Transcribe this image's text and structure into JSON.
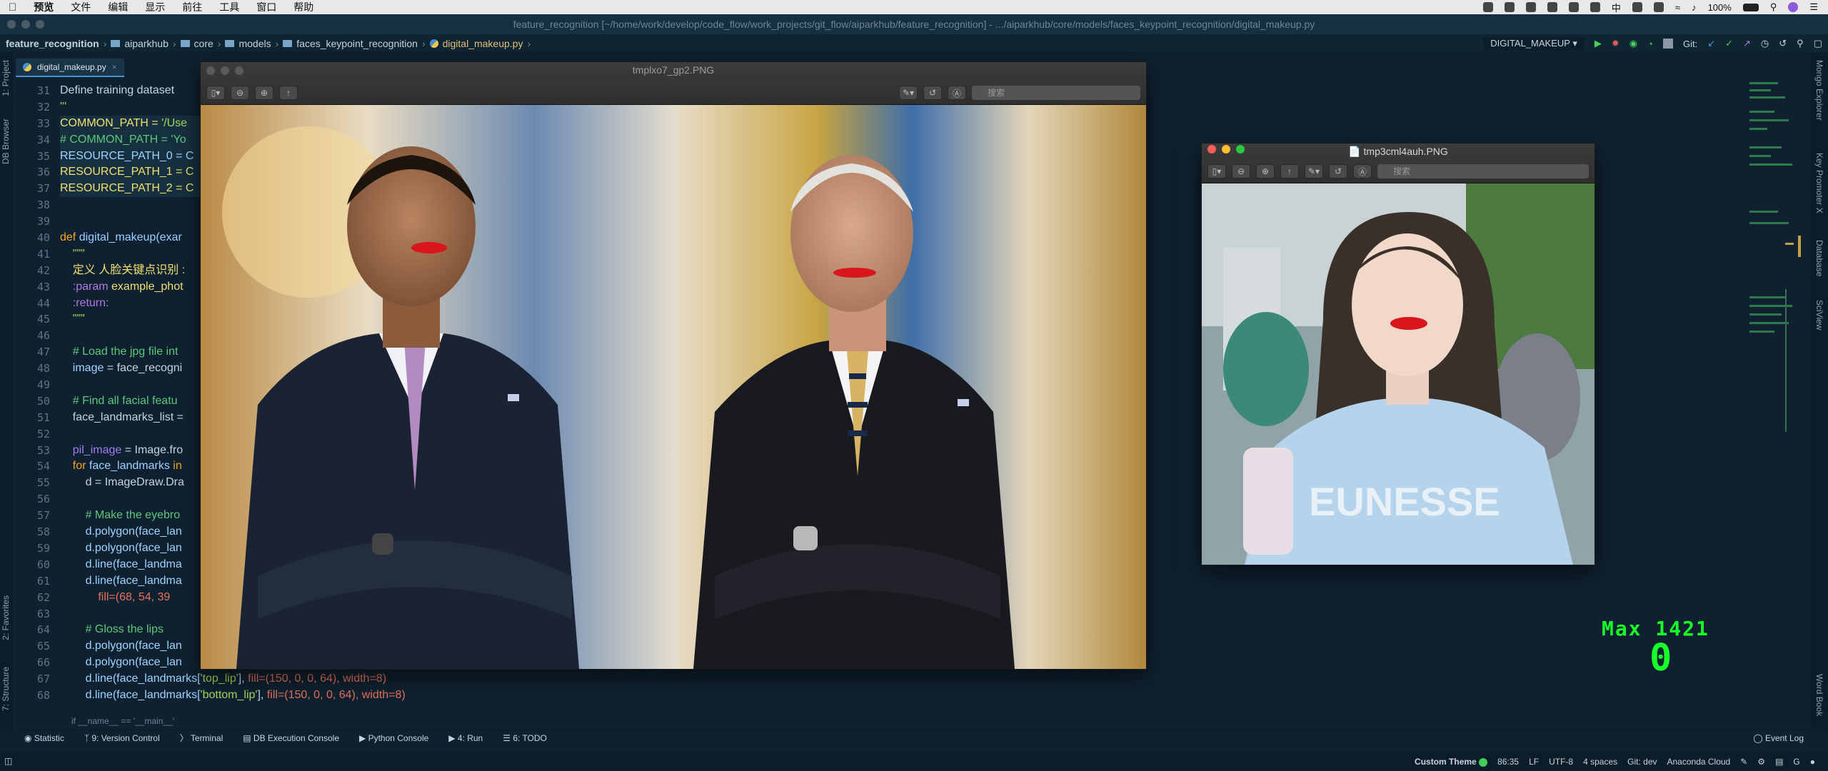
{
  "menubar": {
    "items": [
      "预览",
      "文件",
      "编辑",
      "显示",
      "前往",
      "工具",
      "窗口",
      "帮助"
    ],
    "battery": "100%",
    "input_method": "中"
  },
  "titlebar": {
    "text": "feature_recognition [~/home/work/develop/code_flow/work_projects/git_flow/aiparkhub/feature_recognition] - .../aiparkhub/core/models/faces_keypoint_recognition/digital_makeup.py"
  },
  "navbar": {
    "crumbs": [
      "feature_recognition",
      "aiparkhub",
      "core",
      "models",
      "faces_keypoint_recognition",
      "digital_makeup.py"
    ],
    "run_config": "DIGITAL_MAKEUP",
    "git_label": "Git:"
  },
  "left_tools": {
    "project": "1: Project",
    "db": "DB Browser",
    "favorites": "2: Favorites",
    "structure": "7: Structure"
  },
  "right_tools": {
    "mongo": "Mongo Explorer",
    "key": "Key Promoter X",
    "database": "Database",
    "sciview": "SciView",
    "wordbook": "Word Book"
  },
  "editor": {
    "tab_label": "digital_makeup.py",
    "line_numbers": [
      "31",
      "32",
      "33",
      "34",
      "35",
      "36",
      "37",
      "38",
      "39",
      "40",
      "41",
      "42",
      "43",
      "44",
      "45",
      "46",
      "47",
      "48",
      "49",
      "50",
      "51",
      "52",
      "53",
      "54",
      "55",
      "56",
      "57",
      "58",
      "59",
      "60",
      "61",
      "62",
      "63",
      "64",
      "65",
      "66",
      "67",
      "68"
    ],
    "lines": [
      [
        {
          "c": "df",
          "t": "Define training dataset"
        }
      ],
      [
        {
          "c": "st",
          "t": "'''"
        }
      ],
      [
        {
          "c": "yw",
          "t": "COMMON_PATH = "
        },
        {
          "c": "st",
          "t": "'/Use"
        }
      ],
      [
        {
          "c": "cm",
          "t": "# COMMON_PATH = 'Yo"
        }
      ],
      [
        {
          "c": "cn",
          "t": "RESOURCE_PATH_0 = C"
        }
      ],
      [
        {
          "c": "yw",
          "t": "RESOURCE_PATH_1 = C"
        }
      ],
      [
        {
          "c": "yw",
          "t": "RESOURCE_PATH_2 = C"
        }
      ],
      [
        {
          "c": "df",
          "t": ""
        }
      ],
      [
        {
          "c": "df",
          "t": ""
        }
      ],
      [
        {
          "c": "kw",
          "t": "def "
        },
        {
          "c": "fn",
          "t": "digital_makeup(exar"
        }
      ],
      [
        {
          "c": "st",
          "t": "    \"\"\""
        }
      ],
      [
        {
          "c": "yw",
          "t": "    定义 人脸关键点识别 :"
        }
      ],
      [
        {
          "c": "pm",
          "t": "    :param "
        },
        {
          "c": "yw",
          "t": "example_phot"
        }
      ],
      [
        {
          "c": "pm",
          "t": "    :return:"
        }
      ],
      [
        {
          "c": "st",
          "t": "    \"\"\""
        }
      ],
      [
        {
          "c": "df",
          "t": ""
        }
      ],
      [
        {
          "c": "cm",
          "t": "    # Load the jpg file int"
        }
      ],
      [
        {
          "c": "cn",
          "t": "    image"
        },
        {
          "c": "df",
          "t": " = face_recogni"
        }
      ],
      [
        {
          "c": "df",
          "t": ""
        }
      ],
      [
        {
          "c": "cm",
          "t": "    # Find all facial featu"
        }
      ],
      [
        {
          "c": "df",
          "t": "    face_landmarks_list ="
        }
      ],
      [
        {
          "c": "df",
          "t": ""
        }
      ],
      [
        {
          "c": "vr",
          "t": "    pil_image"
        },
        {
          "c": "df",
          "t": " = Image.fro"
        }
      ],
      [
        {
          "c": "kw",
          "t": "    for "
        },
        {
          "c": "fn",
          "t": "face_landmarks "
        },
        {
          "c": "kw",
          "t": "in"
        }
      ],
      [
        {
          "c": "df",
          "t": "        d = ImageDraw.Dra"
        }
      ],
      [
        {
          "c": "df",
          "t": ""
        }
      ],
      [
        {
          "c": "cm",
          "t": "        # Make the eyebro"
        }
      ],
      [
        {
          "c": "cn",
          "t": "        d.polygon(face_lan"
        }
      ],
      [
        {
          "c": "cn",
          "t": "        d.polygon(face_lan"
        }
      ],
      [
        {
          "c": "cn",
          "t": "        d.line(face_landma"
        }
      ],
      [
        {
          "c": "cn",
          "t": "        d.line(face_landma"
        }
      ],
      [
        {
          "c": "num",
          "t": "            fill=(68, 54, 39"
        }
      ],
      [
        {
          "c": "df",
          "t": ""
        }
      ],
      [
        {
          "c": "cm",
          "t": "        # Gloss the lips"
        }
      ],
      [
        {
          "c": "cn",
          "t": "        d.polygon(face_lan"
        }
      ],
      [
        {
          "c": "cn",
          "t": "        d.polygon(face_lan"
        }
      ],
      [
        {
          "c": "cn",
          "t": "        d.line(face_landmarks["
        },
        {
          "c": "st",
          "t": "'top_lip'"
        },
        {
          "c": "df",
          "t": "], "
        },
        {
          "c": "num",
          "t": "fill=(150, 0, 0, 64), width=8)"
        }
      ],
      [
        {
          "c": "cn",
          "t": "        d.line(face_landmarks["
        },
        {
          "c": "st",
          "t": "'bottom_lip'"
        },
        {
          "c": "df",
          "t": "], "
        },
        {
          "c": "num",
          "t": "fill=(150, 0, 0, 64), width=8)"
        }
      ]
    ],
    "breadcrumb_hint": "if __name__ == '__main__'"
  },
  "preview1": {
    "title": "tmplxo7_gp2.PNG",
    "search_placeholder": "搜索"
  },
  "preview2": {
    "title": "tmp3cml4auh.PNG",
    "search_placeholder": "搜索",
    "shirt_text": "EUNESSE"
  },
  "overlay": {
    "max_label": "Max 1421",
    "value": "0"
  },
  "tool_tabs": [
    "Statistic",
    "9: Version Control",
    "Terminal",
    "DB Execution Console",
    "Python Console",
    "4: Run",
    "6: TODO"
  ],
  "event_log": "Event Log",
  "status": {
    "theme": "Custom Theme",
    "position": "86:35",
    "line_ending": "LF",
    "encoding": "UTF-8",
    "indent": "4 spaces",
    "branch": "Git: dev",
    "cloud": "Anaconda Cloud"
  },
  "colors": {
    "accent": "#4a8fd0",
    "overlay_green": "#18ff2a",
    "lipstick": "#d8161b"
  }
}
